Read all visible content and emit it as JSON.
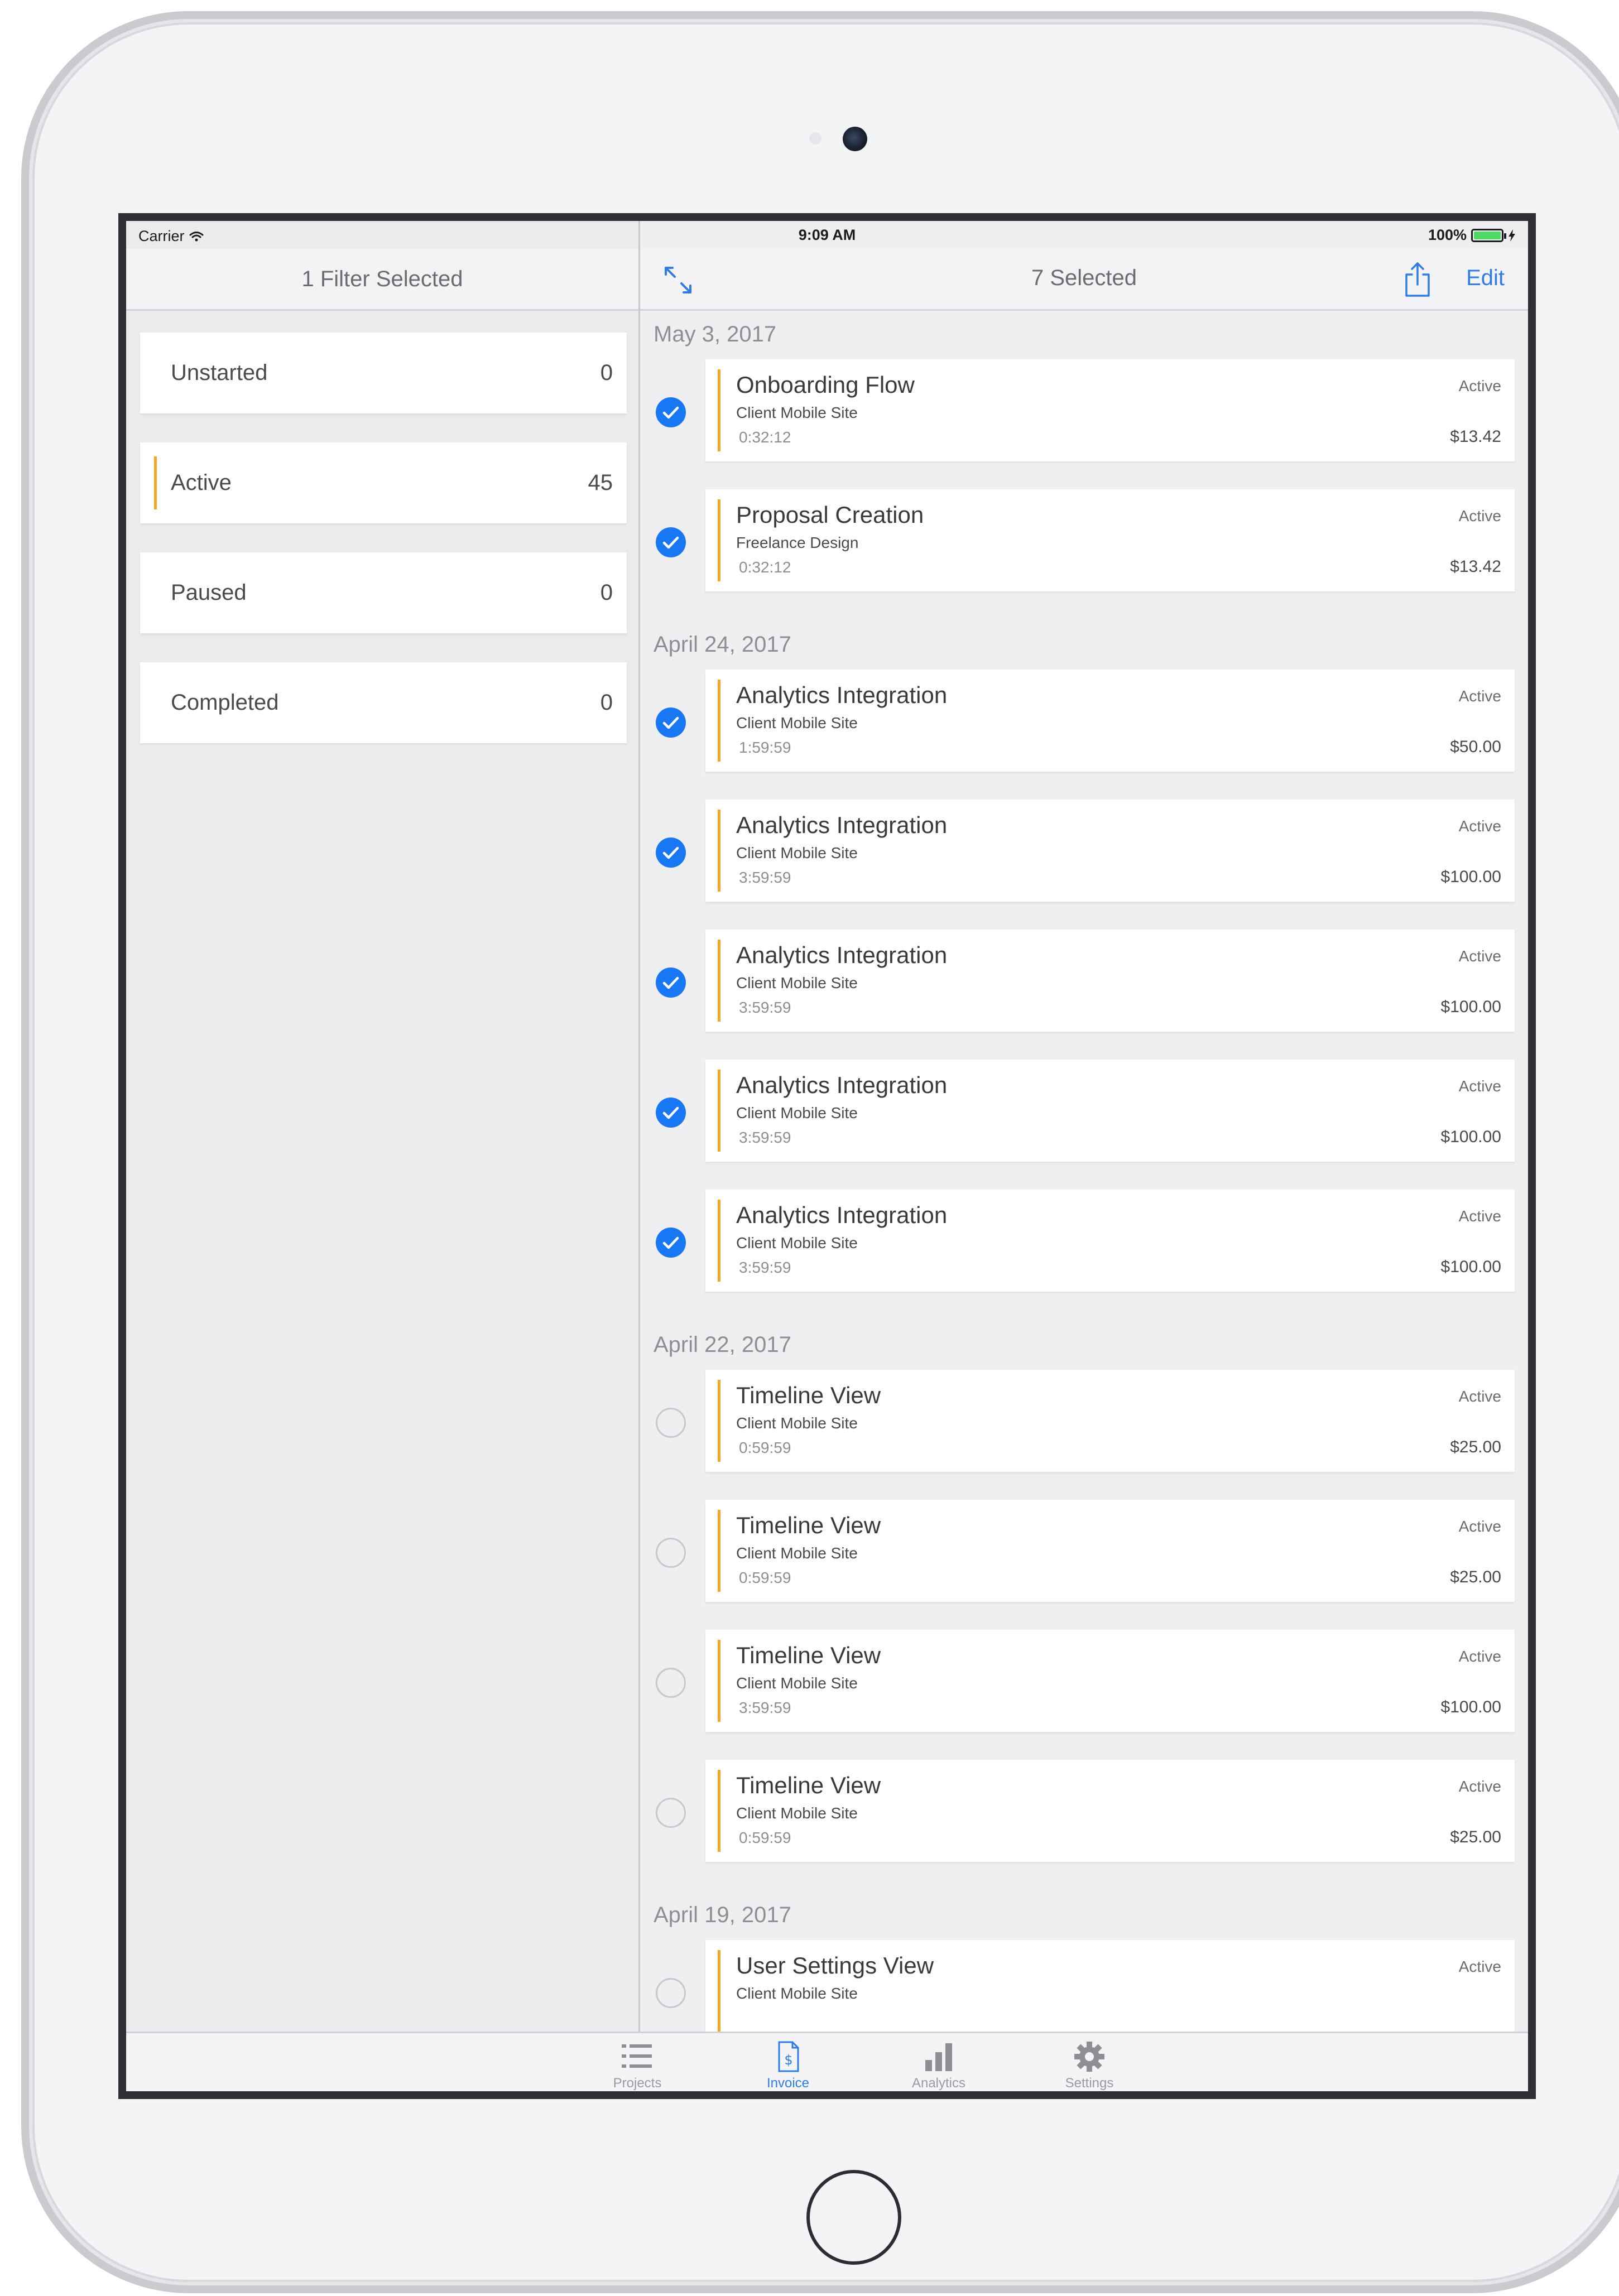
{
  "status_bar": {
    "carrier": "Carrier",
    "time": "9:09 AM",
    "battery": "100%"
  },
  "left_pane": {
    "title": "1 Filter Selected",
    "filters": [
      {
        "label": "Unstarted",
        "count": "0",
        "active": false
      },
      {
        "label": "Active",
        "count": "45",
        "active": true
      },
      {
        "label": "Paused",
        "count": "0",
        "active": false
      },
      {
        "label": "Completed",
        "count": "0",
        "active": false
      }
    ]
  },
  "right_pane": {
    "title": "7 Selected",
    "edit_label": "Edit",
    "groups": [
      {
        "date": "May 3, 2017",
        "items": [
          {
            "title": "Onboarding Flow",
            "client": "Client Mobile Site",
            "time": "0:32:12",
            "status": "Active",
            "amount": "$13.42",
            "selected": true
          },
          {
            "title": "Proposal Creation",
            "client": "Freelance Design",
            "time": "0:32:12",
            "status": "Active",
            "amount": "$13.42",
            "selected": true
          }
        ]
      },
      {
        "date": "April 24, 2017",
        "items": [
          {
            "title": "Analytics Integration",
            "client": "Client Mobile Site",
            "time": "1:59:59",
            "status": "Active",
            "amount": "$50.00",
            "selected": true
          },
          {
            "title": "Analytics Integration",
            "client": "Client Mobile Site",
            "time": "3:59:59",
            "status": "Active",
            "amount": "$100.00",
            "selected": true
          },
          {
            "title": "Analytics Integration",
            "client": "Client Mobile Site",
            "time": "3:59:59",
            "status": "Active",
            "amount": "$100.00",
            "selected": true
          },
          {
            "title": "Analytics Integration",
            "client": "Client Mobile Site",
            "time": "3:59:59",
            "status": "Active",
            "amount": "$100.00",
            "selected": true
          },
          {
            "title": "Analytics Integration",
            "client": "Client Mobile Site",
            "time": "3:59:59",
            "status": "Active",
            "amount": "$100.00",
            "selected": true
          }
        ]
      },
      {
        "date": "April 22, 2017",
        "items": [
          {
            "title": "Timeline View",
            "client": "Client Mobile Site",
            "time": "0:59:59",
            "status": "Active",
            "amount": "$25.00",
            "selected": false
          },
          {
            "title": "Timeline View",
            "client": "Client Mobile Site",
            "time": "0:59:59",
            "status": "Active",
            "amount": "$25.00",
            "selected": false
          },
          {
            "title": "Timeline View",
            "client": "Client Mobile Site",
            "time": "3:59:59",
            "status": "Active",
            "amount": "$100.00",
            "selected": false
          },
          {
            "title": "Timeline View",
            "client": "Client Mobile Site",
            "time": "0:59:59",
            "status": "Active",
            "amount": "$25.00",
            "selected": false
          }
        ]
      },
      {
        "date": "April 19, 2017",
        "items": [
          {
            "title": "User Settings View",
            "client": "Client Mobile Site",
            "time": "",
            "status": "Active",
            "amount": "",
            "selected": false
          }
        ]
      }
    ]
  },
  "tab_bar": {
    "tabs": [
      {
        "label": "Projects",
        "icon": "list-icon",
        "selected": false
      },
      {
        "label": "Invoice",
        "icon": "invoice-icon",
        "selected": true
      },
      {
        "label": "Analytics",
        "icon": "bar-chart-icon",
        "selected": false
      },
      {
        "label": "Settings",
        "icon": "gear-icon",
        "selected": false
      }
    ]
  },
  "colors": {
    "accent": "#2f7ce3",
    "check_blue": "#1877f2",
    "status_bar_orange": "#f5a623",
    "battery_green": "#4cd964"
  }
}
